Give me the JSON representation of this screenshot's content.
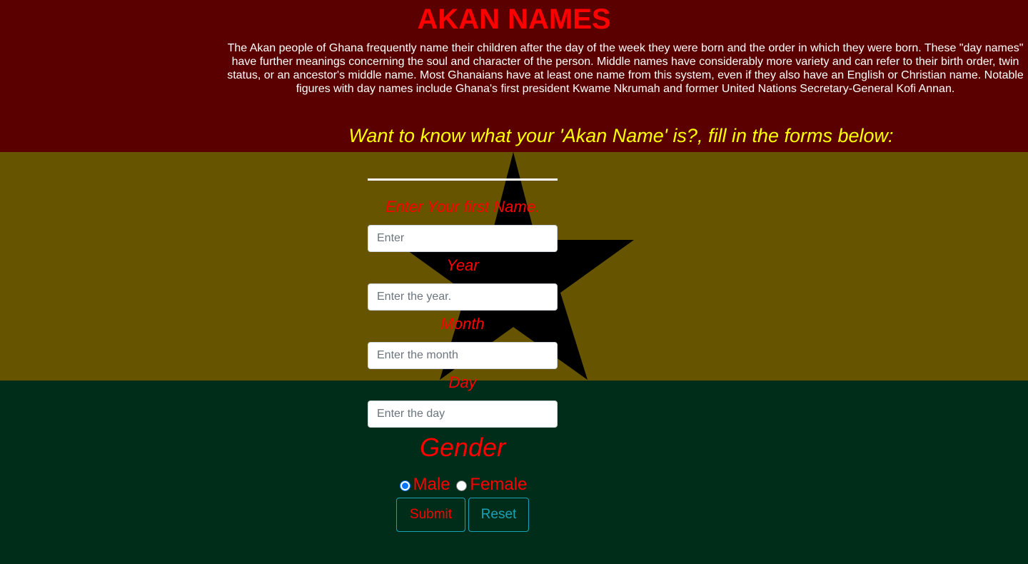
{
  "header": {
    "title": "AKAN NAMES",
    "intro": "The Akan people of Ghana frequently name their children after the day of the week they were born and the order in which they were born. These \"day names\" have further meanings concerning the soul and character of the person. Middle names have considerably more variety and can refer to their birth order, twin status, or an ancestor's middle name. Most Ghanaians have at least one name from this system, even if they also have an English or Christian name. Notable figures with day names include Ghana's first president Kwame Nkrumah and former United Nations Secretary-General Kofi Annan.",
    "prompt": "Want to know what your 'Akan Name' is?, fill in the forms below:"
  },
  "form": {
    "first_name": {
      "label": "Enter Your first Name.",
      "placeholder": "Enter",
      "value": ""
    },
    "year": {
      "label": "Year",
      "placeholder": "Enter the year.",
      "value": ""
    },
    "month": {
      "label": "Month",
      "placeholder": "Enter the month",
      "value": ""
    },
    "day": {
      "label": "Day",
      "placeholder": "Enter the day",
      "value": ""
    },
    "gender": {
      "label": "Gender",
      "options": [
        "Male",
        "Female"
      ],
      "selected": "Male"
    },
    "submit_label": "Submit",
    "reset_label": "Reset"
  },
  "colors": {
    "flag_red": "#5a0000",
    "flag_gold": "#665400",
    "flag_green": "#002d1a",
    "star": "#000000",
    "label_red": "#ff0000",
    "prompt_yellow": "#ffff00",
    "button_border": "#17a2b8"
  }
}
